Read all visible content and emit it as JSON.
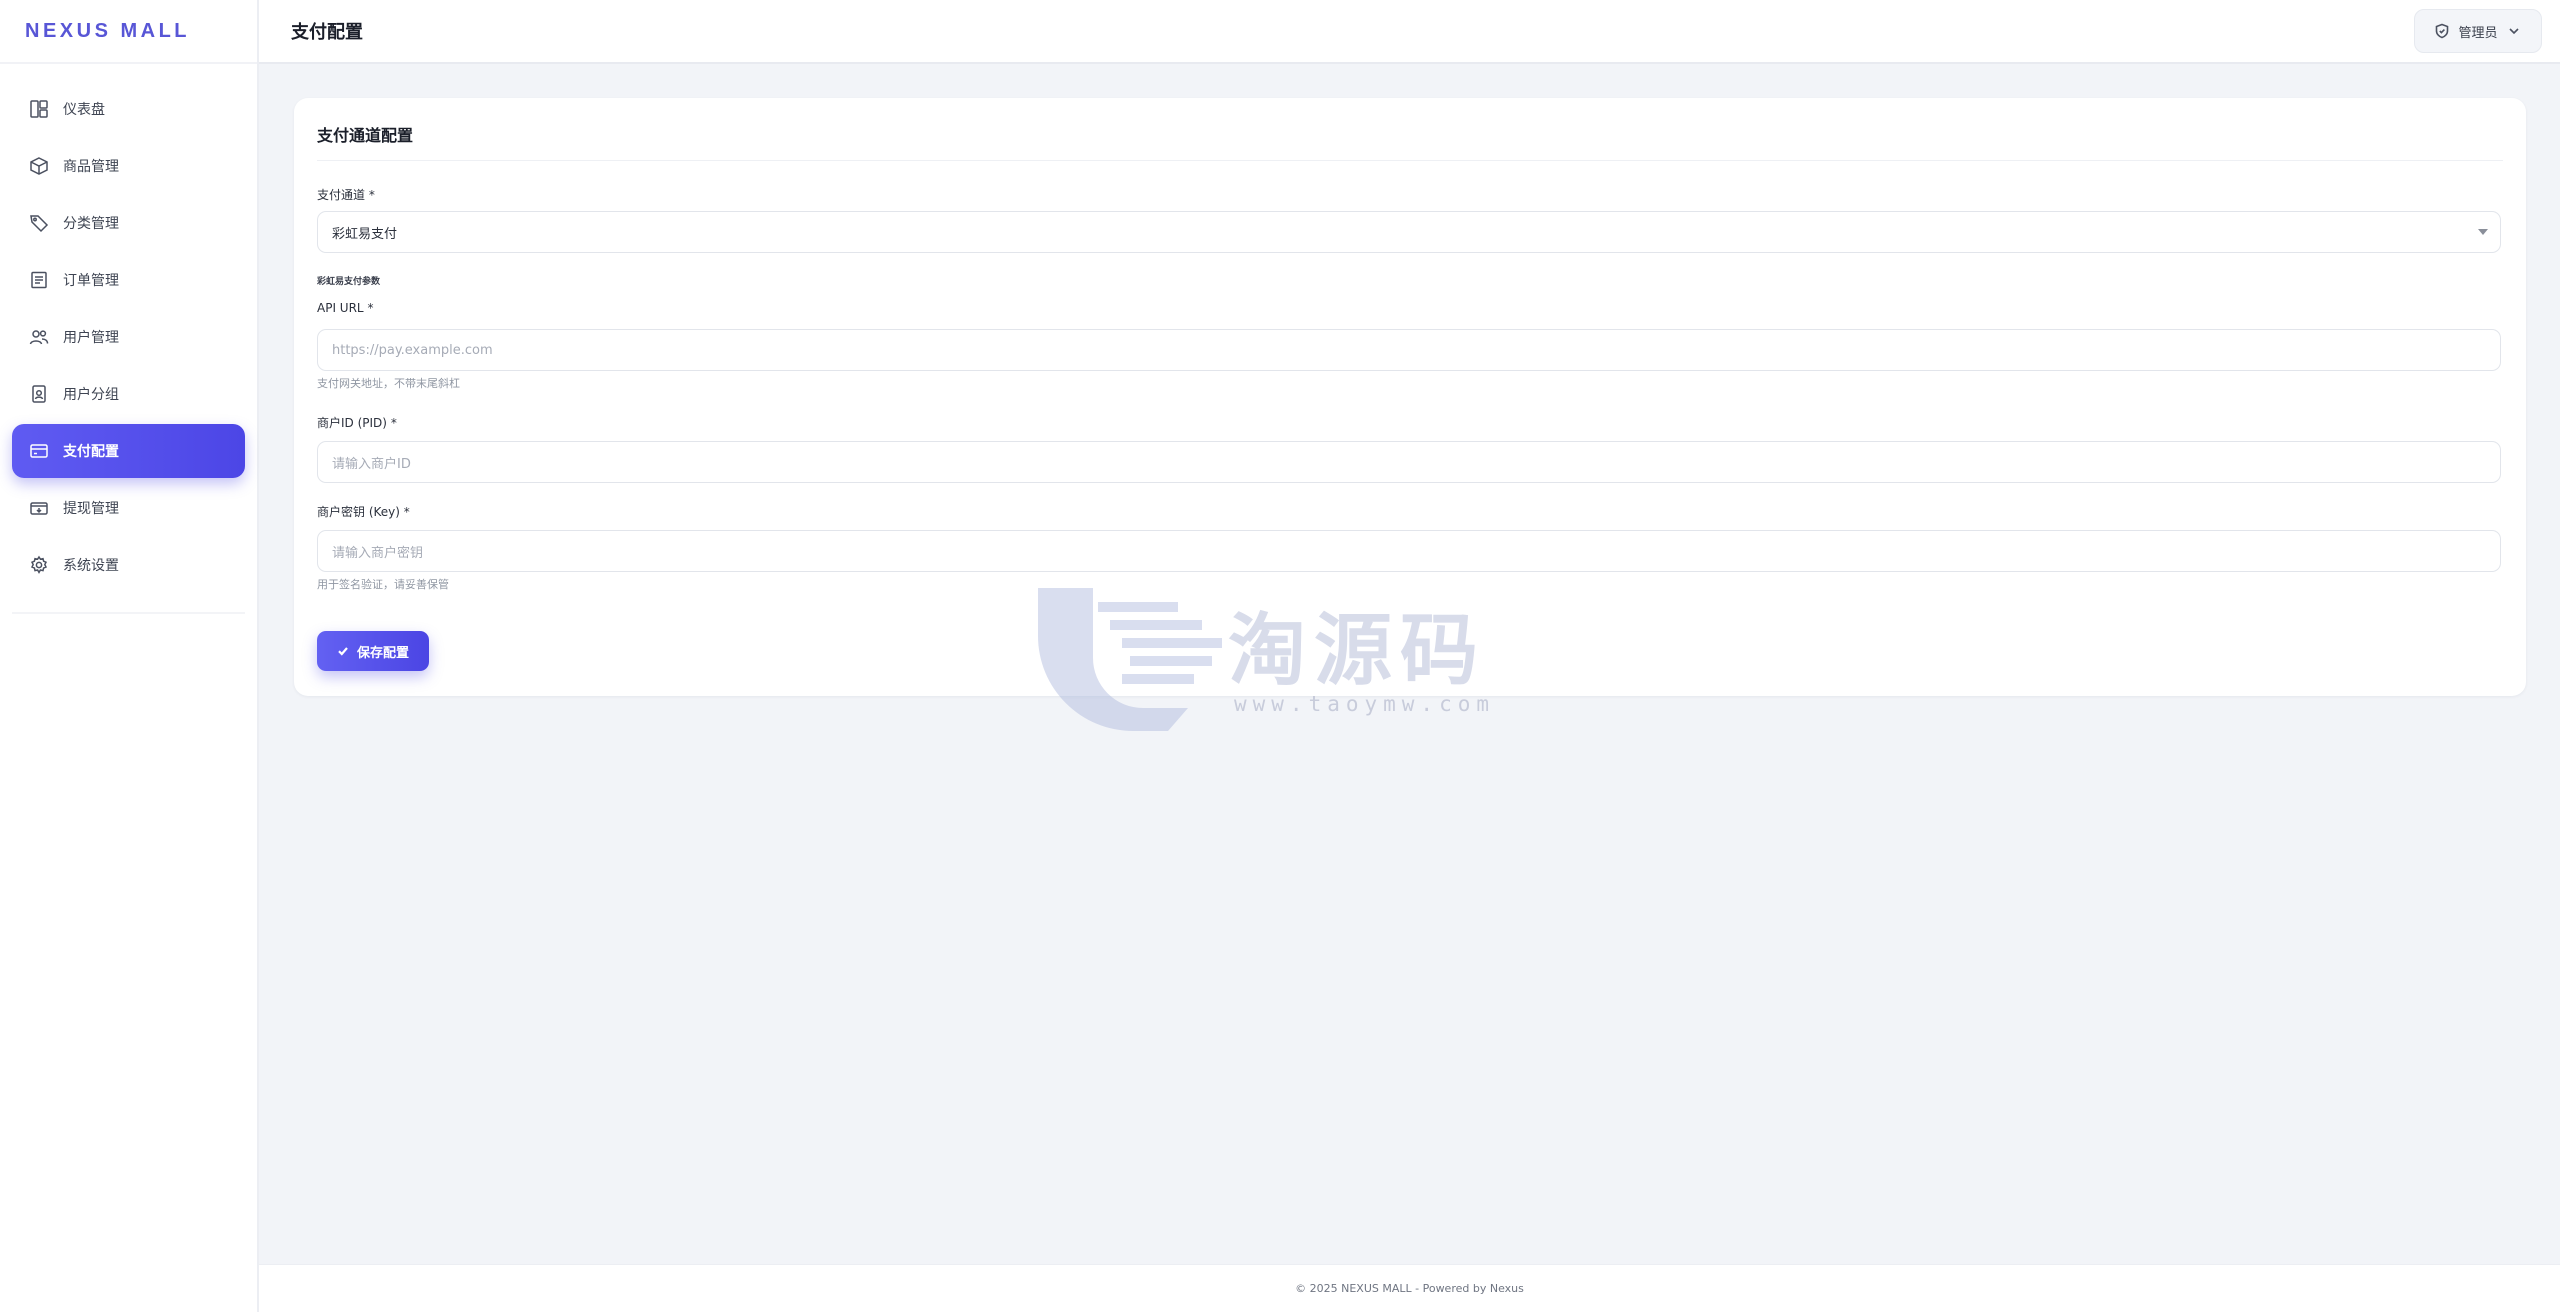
{
  "brand": {
    "name": "NEXUS MALL"
  },
  "sidebar": {
    "items": [
      {
        "label": "仪表盘",
        "icon": "dashboard-icon",
        "active": false
      },
      {
        "label": "商品管理",
        "icon": "box-icon",
        "active": false
      },
      {
        "label": "分类管理",
        "icon": "tag-icon",
        "active": false
      },
      {
        "label": "订单管理",
        "icon": "receipt-icon",
        "active": false
      },
      {
        "label": "用户管理",
        "icon": "users-icon",
        "active": false
      },
      {
        "label": "用户分组",
        "icon": "user-badge-icon",
        "active": false
      },
      {
        "label": "支付配置",
        "icon": "credit-card-icon",
        "active": true
      },
      {
        "label": "提现管理",
        "icon": "withdraw-icon",
        "active": false
      },
      {
        "label": "系统设置",
        "icon": "gear-icon",
        "active": false
      }
    ]
  },
  "header": {
    "title": "支付配置",
    "user_label": "管理员"
  },
  "card": {
    "title": "支付通道配置",
    "channel": {
      "label": "支付通道",
      "required": "*",
      "value": "彩虹易支付"
    },
    "section_tag": "彩虹易支付参数",
    "api_url": {
      "label": "API URL",
      "required": "*",
      "placeholder": "https://pay.example.com",
      "help": "支付网关地址，不带末尾斜杠"
    },
    "pid": {
      "label": "商户ID (PID)",
      "required": "*",
      "placeholder": "请输入商户ID"
    },
    "key": {
      "label": "商户密钥 (Key)",
      "required": "*",
      "placeholder": "请输入商户密钥",
      "help": "用于签名验证，请妥善保管"
    },
    "save_label": "保存配置"
  },
  "watermark": {
    "text": "淘源码",
    "sub": "www.taoymw.com"
  },
  "footer": {
    "text": "© 2025 NEXUS MALL - Powered by Nexus"
  },
  "colors": {
    "accent": "#5856d6",
    "background": "#f2f4f8",
    "card": "#ffffff"
  }
}
